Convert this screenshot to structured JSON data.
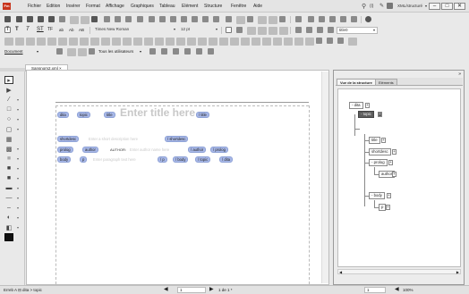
{
  "app": {
    "logo_text": "Fm"
  },
  "menu": [
    "Fichier",
    "Edition",
    "Insérer",
    "Format",
    "Affichage",
    "Graphiques",
    "Tableau",
    "Elément",
    "Structure",
    "Fenêtre",
    "Aide"
  ],
  "workspace": {
    "label": "XML/structuré",
    "minimize": "–",
    "maximize": "□",
    "close": "✕"
  },
  "format_bar": {
    "text_buttons": [
      "T",
      "T",
      "T",
      "ST",
      "TF",
      "ab",
      "Ab",
      "AB"
    ],
    "font": "Times New Roman",
    "size": "12 pt",
    "para_style": "title0"
  },
  "track_bar": {
    "doc_label": "Document",
    "users_label": "Tous les utilisateurs"
  },
  "document": {
    "tab_label": "Sansnom2.xml",
    "tab_close": "×",
    "title_placeholder": "Enter title here",
    "shortdesc_placeholder": "Enter a short description here",
    "author_label": "AUTHOR:",
    "author_placeholder": "Enter author name here",
    "para_placeholder": "Enter paragraph text here",
    "tags": {
      "dita": "dita",
      "topic": "topic",
      "title": "title",
      "title_end": "/ title",
      "shortdesc": "shortdesc",
      "shortdesc_end": "/ shortdesc",
      "prolog": "prolog",
      "author": "author",
      "author_end": "/ author",
      "prolog_end": "/ prolog",
      "body": "body",
      "p": "p",
      "p_end": "/ p",
      "body_end": "/ body",
      "topic_end": "/ topic",
      "dita_end": "/ dita"
    }
  },
  "structure_panel": {
    "tab_structure": "Vue de la structure",
    "tab_elements": "Eléments",
    "nodes": {
      "dita": "dita",
      "topic": "topic",
      "title": "title",
      "shortdesc": "shortdesc",
      "prolog": "prolog",
      "author": "author",
      "body": "body",
      "p": "p"
    },
    "expand": "-",
    "add": "+"
  },
  "status": {
    "element_path": "Erreb   A  ⊟ dita > topic",
    "page_value": "1",
    "page_total": "1 de 1 *",
    "zoom_value": "1",
    "zoom": "100%"
  }
}
